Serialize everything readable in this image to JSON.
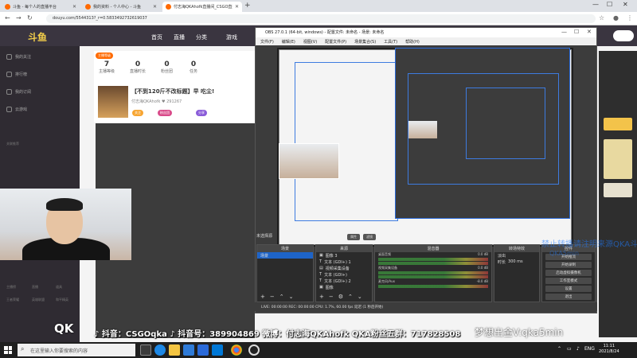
{
  "browser": {
    "tabs": [
      {
        "title": "斗鱼 - 每个人的直播平台"
      },
      {
        "title": "我的资料 - 个人中心 - 斗鱼"
      },
      {
        "title": "付志海QKAhofk直播间_CSGO直播"
      }
    ],
    "url": "douyu.com/5544313?_r=0.5833492732619037"
  },
  "site": {
    "logo": "斗鱼",
    "nav": [
      "首页",
      "直播",
      "分类",
      "游戏"
    ],
    "sidebar": [
      "我的关注",
      "排行榜",
      "我的订阅",
      "云游戏"
    ],
    "sidebar_section": "关联推荐",
    "sidebar_bottom": [
      "主播榜",
      "直播",
      "道具",
      "王者荣耀",
      "英雄联盟",
      "和平精英"
    ],
    "room": {
      "tag": "主播等级",
      "stats": [
        {
          "value": "7",
          "label": "主播等级"
        },
        {
          "value": "0",
          "label": "直播时长"
        },
        {
          "value": "0",
          "label": "粉丝团"
        },
        {
          "value": "0",
          "label": "任务"
        }
      ],
      "title": "【不到120斤不改标题】早 吃尘!",
      "meta": "付志海QKAhofk  ♥ 291267",
      "badges": [
        "关注",
        "粉丝团",
        "分享"
      ]
    }
  },
  "ticker": {
    "logo": "QK",
    "main": "♪ 抖音：CSGOqka  ♪ 抖音号：389904869  微博：付志海QKAhofk  QKA粉丝五群：717828508",
    "slogan": "梦想出金V:qka5min"
  },
  "obs": {
    "title": "OBS 27.0.1 (64-bit, windows) - 配置文件: 未命名 - 场景: 未命名",
    "menu": [
      "文件(F)",
      "编辑(E)",
      "视图(V)",
      "配置文件(P)",
      "场景集合(S)",
      "工具(T)",
      "帮助(H)"
    ],
    "scene_label": "未选择源",
    "scene_buttons": [
      "属性",
      "滤镜"
    ],
    "docks": {
      "scenes": {
        "title": "场景",
        "items": [
          "场景"
        ]
      },
      "sources": {
        "title": "来源",
        "items": [
          "图像 3",
          "文本 (GDI+) 1",
          "视频采集设备",
          "文本 (GDI+)",
          "文本 (GDI+) 2",
          "图像"
        ]
      },
      "mixer": {
        "title": "混音器",
        "channels": [
          {
            "name": "桌面音频",
            "db": "0.0 dB"
          },
          {
            "name": "视频采集设备",
            "db": "0.0 dB"
          },
          {
            "name": "麦克风/Aux",
            "db": "-8.0 dB"
          }
        ]
      },
      "transitions": {
        "title": "转场特效",
        "type": "淡出",
        "duration_label": "时长",
        "duration": "300 ms"
      },
      "controls": {
        "title": "控件",
        "buttons": [
          "开始推流",
          "开始录制",
          "启动虚拟摄像机",
          "工作室模式",
          "设置",
          "退出"
        ]
      }
    },
    "status": "LIVE: 00:00:00   REC: 00:00:00   CPU: 1.7%, 60.00 fps   延迟 (1 秒后开始)",
    "watermark": "禁止转播请注明来源QKA斗鱼",
    "watermark2": "QKA5min"
  },
  "taskbar": {
    "search_placeholder": "在这里输入你要搜索的内容",
    "lang": "ENG",
    "time": "11:11",
    "date": "2021/8/24"
  }
}
